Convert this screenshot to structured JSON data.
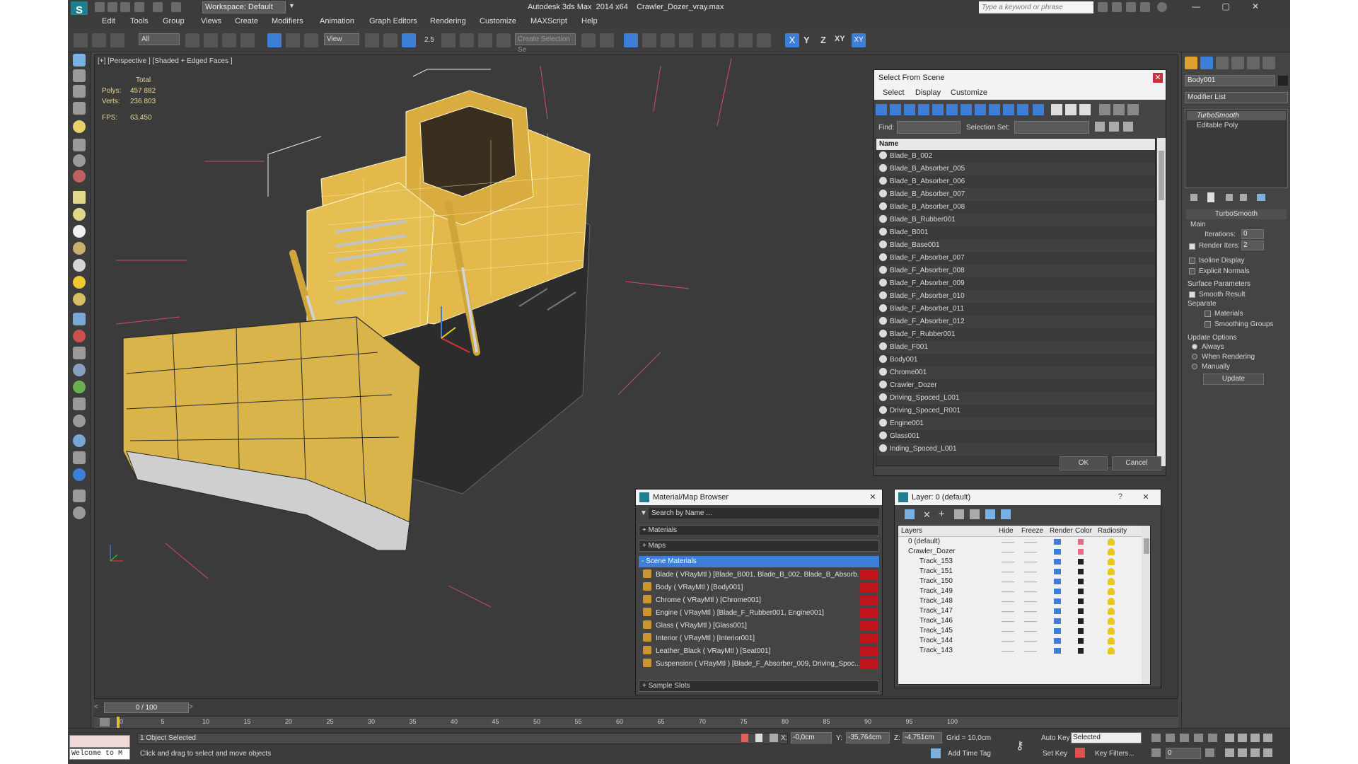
{
  "titlebar": {
    "workspace": "Workspace: Default",
    "app_title": "Autodesk 3ds Max  2014 x64    Crawler_Dozer_vray.max",
    "search_placeholder": "Type a keyword or phrase"
  },
  "menu": [
    "Edit",
    "Tools",
    "Group",
    "Views",
    "Create",
    "Modifiers",
    "Animation",
    "Graph Editors",
    "Rendering",
    "Customize",
    "MAXScript",
    "Help"
  ],
  "toolbar": {
    "selection_filter": "All",
    "ref_coord": "View",
    "snap_angle": "2.5",
    "named_selection_placeholder": "Create Selection Se",
    "axis_labels": [
      "X",
      "Y",
      "Z",
      "XY",
      "XY"
    ]
  },
  "viewport": {
    "label": "[+] [Perspective ] [Shaded + Edged Faces ]",
    "stats_header": "Total",
    "polys_label": "Polys:",
    "polys_value": "457 882",
    "verts_label": "Verts:",
    "verts_value": "236 803",
    "fps_label": "FPS:",
    "fps_value": "63,450"
  },
  "command_panel": {
    "object_name": "Body001",
    "modifier_list": "Modifier List",
    "stack": [
      "TurboSmooth",
      "Editable Poly"
    ],
    "rollout_title": "TurboSmooth",
    "main_label": "Main",
    "iterations_label": "Iterations:",
    "iterations_value": "0",
    "render_iters_label": "Render Iters:",
    "render_iters_value": "2",
    "isoline_label": "Isoline Display",
    "explicit_normals_label": "Explicit Normals",
    "surface_params_label": "Surface Parameters",
    "smooth_result_label": "Smooth Result",
    "separate_label": "Separate",
    "materials_label": "Materials",
    "smoothing_groups_label": "Smoothing Groups",
    "update_options_label": "Update Options",
    "always_label": "Always",
    "when_rendering_label": "When Rendering",
    "manually_label": "Manually",
    "update_button": "Update"
  },
  "select_from_scene": {
    "title": "Select From Scene",
    "tabs": [
      "Select",
      "Display",
      "Customize"
    ],
    "find_label": "Find:",
    "selection_set_label": "Selection Set:",
    "column_name": "Name",
    "items": [
      "Blade_B_002",
      "Blade_B_Absorber_005",
      "Blade_B_Absorber_006",
      "Blade_B_Absorber_007",
      "Blade_B_Absorber_008",
      "Blade_B_Rubber001",
      "Blade_B001",
      "Blade_Base001",
      "Blade_F_Absorber_007",
      "Blade_F_Absorber_008",
      "Blade_F_Absorber_009",
      "Blade_F_Absorber_010",
      "Blade_F_Absorber_011",
      "Blade_F_Absorber_012",
      "Blade_F_Rubber001",
      "Blade_F001",
      "Body001",
      "Chrome001",
      "Crawler_Dozer",
      "Driving_Spoced_L001",
      "Driving_Spoced_R001",
      "Engine001",
      "Glass001",
      "Inding_Spoced_L001"
    ],
    "ok": "OK",
    "cancel": "Cancel"
  },
  "material_browser": {
    "title": "Material/Map Browser",
    "search_placeholder": "Search by Name ...",
    "groups": [
      "+ Materials",
      "+ Maps",
      "- Scene Materials"
    ],
    "scene_materials": [
      "Blade  ( VRayMtl ) [Blade_B001, Blade_B_002, Blade_B_Absorb...",
      "Body  ( VRayMtl ) [Body001]",
      "Chrome  ( VRayMtl ) [Chrome001]",
      "Engine  ( VRayMtl ) [Blade_F_Rubber001, Engine001]",
      "Glass  ( VRayMtl ) [Glass001]",
      "Interior  ( VRayMtl ) [Interior001]",
      "Leather_Black  ( VRayMtl ) [Seat001]",
      "Suspension  ( VRayMtl ) [Blade_F_Absorber_009, Driving_Spoc..."
    ],
    "sample_slots": "+ Sample Slots"
  },
  "layer_explorer": {
    "title": "Layer: 0 (default)",
    "help": "?",
    "columns": [
      "Layers",
      "Hide",
      "Freeze",
      "Render",
      "Color",
      "Radiosity"
    ],
    "rows": [
      {
        "name": "0 (default)",
        "color": "#e86a8a"
      },
      {
        "name": "Crawler_Dozer",
        "color": "#e86a8a"
      },
      {
        "name": "Track_153",
        "color": "#222222"
      },
      {
        "name": "Track_151",
        "color": "#222222"
      },
      {
        "name": "Track_150",
        "color": "#222222"
      },
      {
        "name": "Track_149",
        "color": "#222222"
      },
      {
        "name": "Track_148",
        "color": "#222222"
      },
      {
        "name": "Track_147",
        "color": "#222222"
      },
      {
        "name": "Track_146",
        "color": "#222222"
      },
      {
        "name": "Track_145",
        "color": "#222222"
      },
      {
        "name": "Track_144",
        "color": "#222222"
      },
      {
        "name": "Track_143",
        "color": "#222222"
      }
    ]
  },
  "timeline": {
    "frame_readout": "0 / 100",
    "ticks": [
      "0",
      "5",
      "10",
      "15",
      "20",
      "25",
      "30",
      "35",
      "40",
      "45",
      "50",
      "55",
      "60",
      "65",
      "70",
      "75",
      "80",
      "85",
      "90",
      "95",
      "100"
    ]
  },
  "status": {
    "welcome": "Welcome to M",
    "selected": "1 Object Selected",
    "prompt": "Click and drag to select and move objects",
    "x_label": "X:",
    "x_value": "-0,0cm",
    "y_label": "Y:",
    "y_value": "-35,764cm",
    "z_label": "Z:",
    "z_value": "-4,751cm",
    "grid": "Grid = 10,0cm",
    "add_time_tag": "Add Time Tag",
    "auto_key": "Auto Key",
    "set_key": "Set Key",
    "key_mode": "Selected",
    "key_filters": "Key Filters...",
    "frame": "0"
  },
  "colors": {
    "accent": "#3d7fd6",
    "dozer_yellow": "#e2b94a",
    "material_red": "#c0141c"
  }
}
